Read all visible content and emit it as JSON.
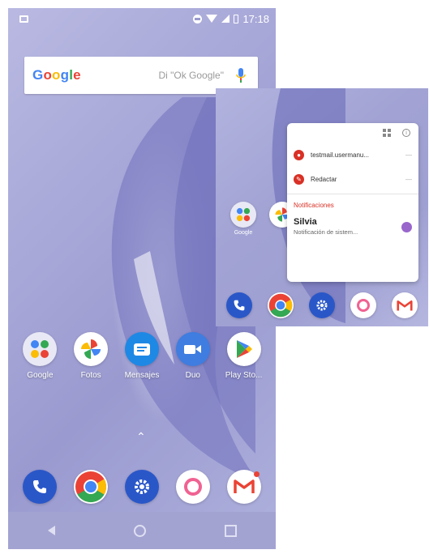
{
  "status_bar": {
    "time": "17:18"
  },
  "google_bar": {
    "logo": "Google",
    "hint": "Di \"Ok Google\""
  },
  "apps_row": [
    {
      "label": "Google",
      "icon": "google-folder-icon"
    },
    {
      "label": "Fotos",
      "icon": "photos-icon"
    },
    {
      "label": "Mensajes",
      "icon": "messages-icon"
    },
    {
      "label": "Duo",
      "icon": "duo-icon"
    },
    {
      "label": "Play Sto...",
      "icon": "play-store-icon"
    }
  ],
  "dock": [
    {
      "name": "phone",
      "icon": "phone-icon"
    },
    {
      "name": "chrome",
      "icon": "chrome-icon"
    },
    {
      "name": "settings",
      "icon": "settings-icon"
    },
    {
      "name": "camera",
      "icon": "camera-icon"
    },
    {
      "name": "gmail",
      "icon": "gmail-icon"
    }
  ],
  "popup": {
    "items": [
      {
        "text": "testmail.usermanu...",
        "icon": "account-icon"
      },
      {
        "text": "Redactar",
        "icon": "compose-icon"
      }
    ],
    "notifications_header": "Notificaciones",
    "notification": {
      "title": "Silvia",
      "text": "Notificación de sistem..."
    }
  },
  "inset_labels": {
    "google_folder": "Google"
  },
  "colors": {
    "google_blue": "#4285F4",
    "google_red": "#EA4335",
    "google_yellow": "#FBBC05",
    "google_green": "#34A853",
    "popup_accent": "#d93025"
  }
}
